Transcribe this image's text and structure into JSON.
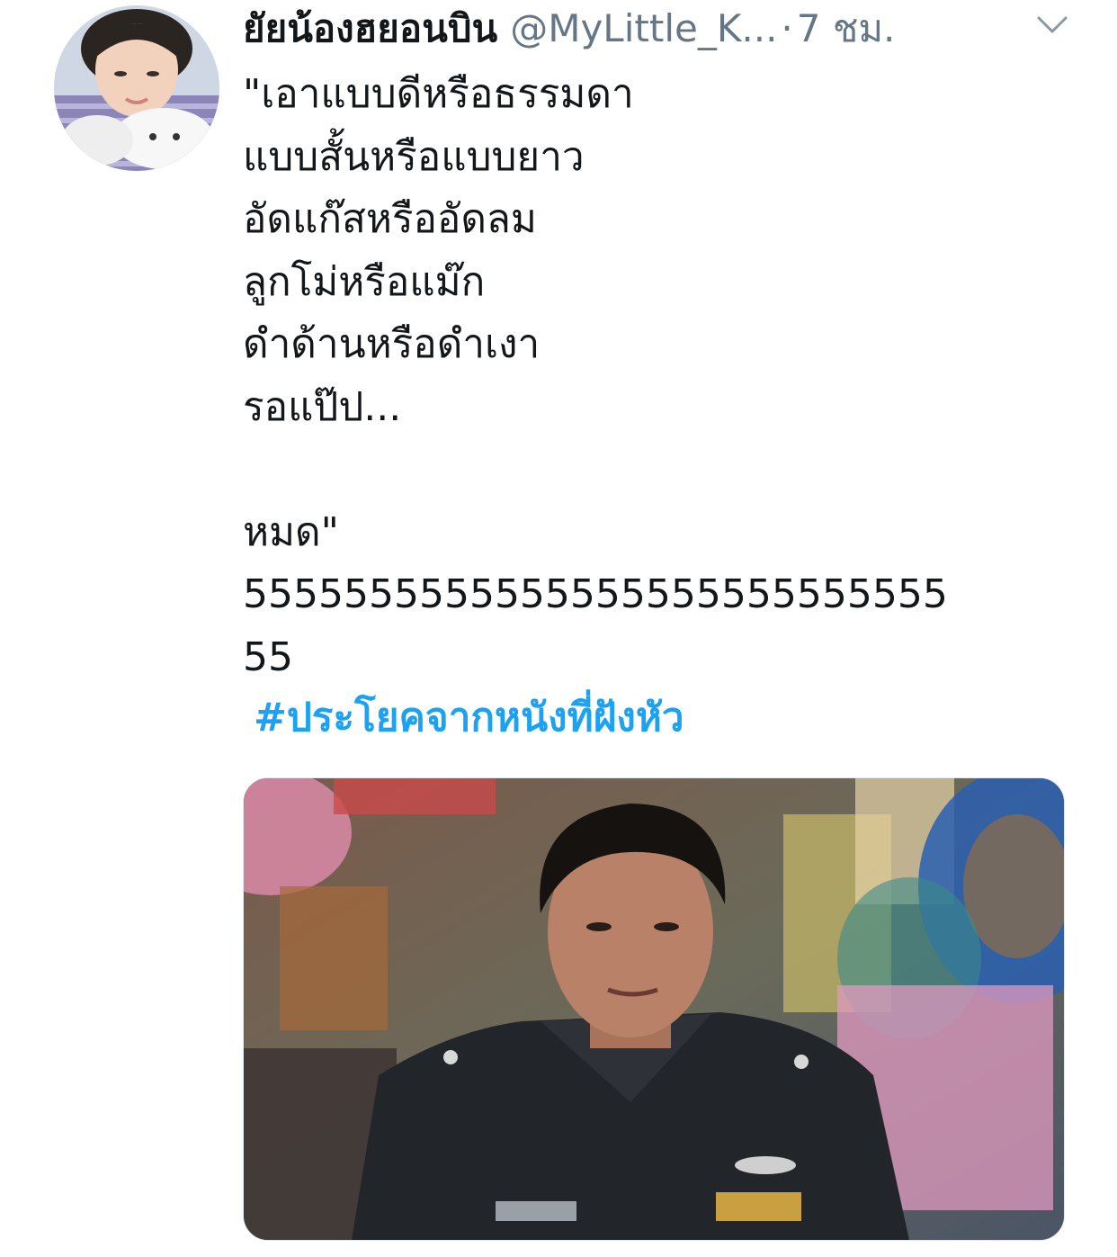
{
  "tweet": {
    "display_name": "ยัยน้องฮยอนบิน",
    "handle": "@MyLittle_K...",
    "separator": "·",
    "timestamp": "7 ชม.",
    "body_lines": [
      "\"เอาแบบดีหรือธรรมดา",
      "แบบสั้นหรือแบบยาว",
      "อัดแก๊สหรืออัดลม",
      "ลูกโม่หรือแม๊ก",
      "ดำด้านหรือดำเงา",
      "รอแป๊ป...",
      "",
      "หมด\"",
      "5555555555555555555555555555",
      "55"
    ],
    "hashtag": "#ประโยคจากหนังที่ฝังหัว"
  },
  "icons": {
    "menu": "chevron-down-icon"
  },
  "colors": {
    "text": "#14171a",
    "secondary": "#657786",
    "link": "#1da1f2"
  }
}
